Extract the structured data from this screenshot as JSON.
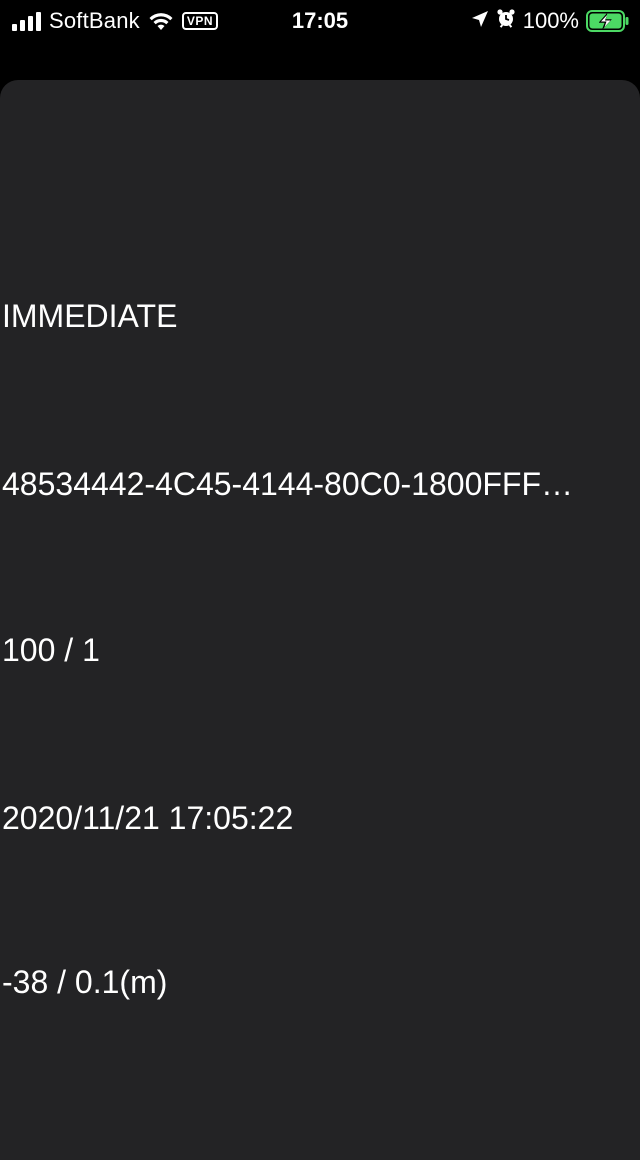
{
  "status_bar": {
    "carrier": "SoftBank",
    "vpn": "VPN",
    "time": "17:05",
    "battery_percent": "100%",
    "icons": [
      "signal-icon",
      "wifi-icon",
      "vpn-badge",
      "location-arrow-icon",
      "alarm-icon",
      "battery-charging-icon"
    ],
    "battery_color": "#4cd964"
  },
  "beacon": {
    "proximity": "IMMEDIATE",
    "uuid": "48534442-4C45-4144-80C0-1800FFF…",
    "major_minor": "100 / 1",
    "timestamp": "2020/11/21 17:05:22",
    "rssi_accuracy": "-38 / 0.1(m)"
  },
  "colors": {
    "background": "#000000",
    "sheet": "#232325",
    "text": "#ffffff"
  }
}
